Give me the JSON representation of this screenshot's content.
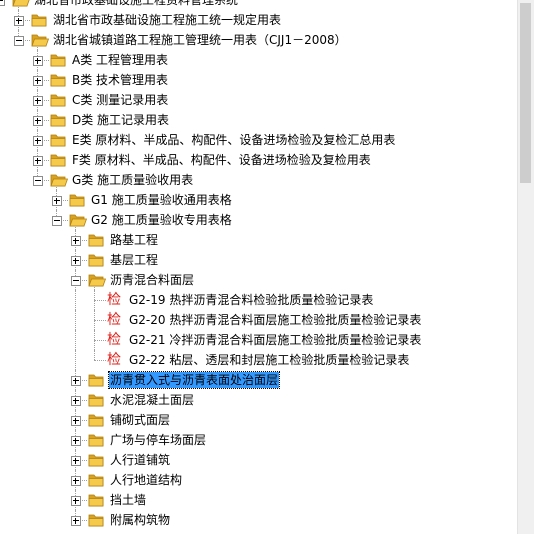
{
  "tree": [
    {
      "level": 0,
      "label": "湖北省市政基础设施工程资料管理系统",
      "state": "open",
      "icon": "folder-open"
    },
    {
      "level": 1,
      "label": "湖北省市政基础设施工程施工统一规定用表",
      "state": "closed",
      "icon": "folder"
    },
    {
      "level": 1,
      "label": "湖北省城镇道路工程施工管理统一用表（CJJ1－2008）",
      "state": "open",
      "icon": "folder-open"
    },
    {
      "level": 2,
      "label": "A类 工程管理用表",
      "state": "closed",
      "icon": "folder"
    },
    {
      "level": 2,
      "label": "B类 技术管理用表",
      "state": "closed",
      "icon": "folder"
    },
    {
      "level": 2,
      "label": "C类 测量记录用表",
      "state": "closed",
      "icon": "folder"
    },
    {
      "level": 2,
      "label": "D类 施工记录用表",
      "state": "closed",
      "icon": "folder"
    },
    {
      "level": 2,
      "label": "E类 原材料、半成品、构配件、设备进场检验及复检汇总用表",
      "state": "closed",
      "icon": "folder"
    },
    {
      "level": 2,
      "label": "F类 原材料、半成品、构配件、设备进场检验及复检用表",
      "state": "closed",
      "icon": "folder"
    },
    {
      "level": 2,
      "label": "G类 施工质量验收用表",
      "state": "open",
      "icon": "folder-open"
    },
    {
      "level": 3,
      "label": "G1 施工质量验收通用表格",
      "state": "closed",
      "icon": "folder"
    },
    {
      "level": 3,
      "label": "G2 施工质量验收专用表格",
      "state": "open",
      "icon": "folder-open"
    },
    {
      "level": 4,
      "label": "路基工程",
      "state": "closed",
      "icon": "folder"
    },
    {
      "level": 4,
      "label": "基层工程",
      "state": "closed",
      "icon": "folder"
    },
    {
      "level": 4,
      "label": "沥青混合料面层",
      "state": "open",
      "icon": "folder-open"
    },
    {
      "level": 5,
      "label": "G2-19 热拌沥青混合料检验批质量检验记录表",
      "state": "leaf",
      "icon": "jian"
    },
    {
      "level": 5,
      "label": "G2-20 热拌沥青混合料面层施工检验批质量检验记录表",
      "state": "leaf",
      "icon": "jian"
    },
    {
      "level": 5,
      "label": "G2-21 冷拌沥青混合料面层施工检验批质量检验记录表",
      "state": "leaf",
      "icon": "jian"
    },
    {
      "level": 5,
      "label": "G2-22 粘层、透层和封层施工检验批质量检验记录表",
      "state": "leaf",
      "icon": "jian"
    },
    {
      "level": 4,
      "label": "沥青贯入式与沥青表面处治面层",
      "state": "closed",
      "icon": "folder",
      "selected": true
    },
    {
      "level": 4,
      "label": "水泥混凝土面层",
      "state": "closed",
      "icon": "folder"
    },
    {
      "level": 4,
      "label": "铺砌式面层",
      "state": "closed",
      "icon": "folder"
    },
    {
      "level": 4,
      "label": "广场与停车场面层",
      "state": "closed",
      "icon": "folder"
    },
    {
      "level": 4,
      "label": "人行道铺筑",
      "state": "closed",
      "icon": "folder"
    },
    {
      "level": 4,
      "label": "人行地道结构",
      "state": "closed",
      "icon": "folder"
    },
    {
      "level": 4,
      "label": "挡土墙",
      "state": "closed",
      "icon": "folder"
    },
    {
      "level": 4,
      "label": "附属构筑物",
      "state": "closed",
      "icon": "folder"
    }
  ],
  "leaf_glyph": "检",
  "colors": {
    "folder": "#f5c94a",
    "folder_dark": "#d9a21f",
    "selection": "#3399ff",
    "leaf_glyph": "#e0211b"
  }
}
